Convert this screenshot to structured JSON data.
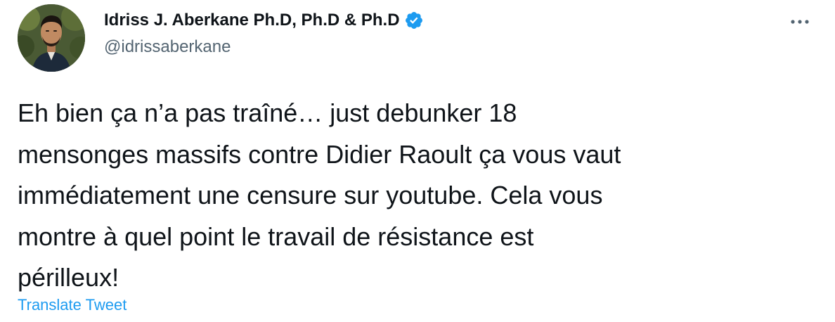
{
  "author": {
    "display_name": "Idriss J. Aberkane Ph.D, Ph.D & Ph.D",
    "handle": "@idrissaberkane",
    "verified_icon": "verified-badge-icon",
    "verified_color": "#1d9bf0"
  },
  "tweet": {
    "text": "Eh bien ça n’a pas traîné… just debunker 18\nmensonges massifs contre Didier Raoult ça vous vaut\nimmédiatement une censure sur youtube. Cela vous\nmontre à quel point le travail de résistance est\npérilleux!",
    "translate_label": "Translate Tweet"
  },
  "actions": {
    "more_icon": "more-options-icon"
  },
  "colors": {
    "text": "#0f1419",
    "secondary": "#536471",
    "link": "#1d9bf0"
  }
}
